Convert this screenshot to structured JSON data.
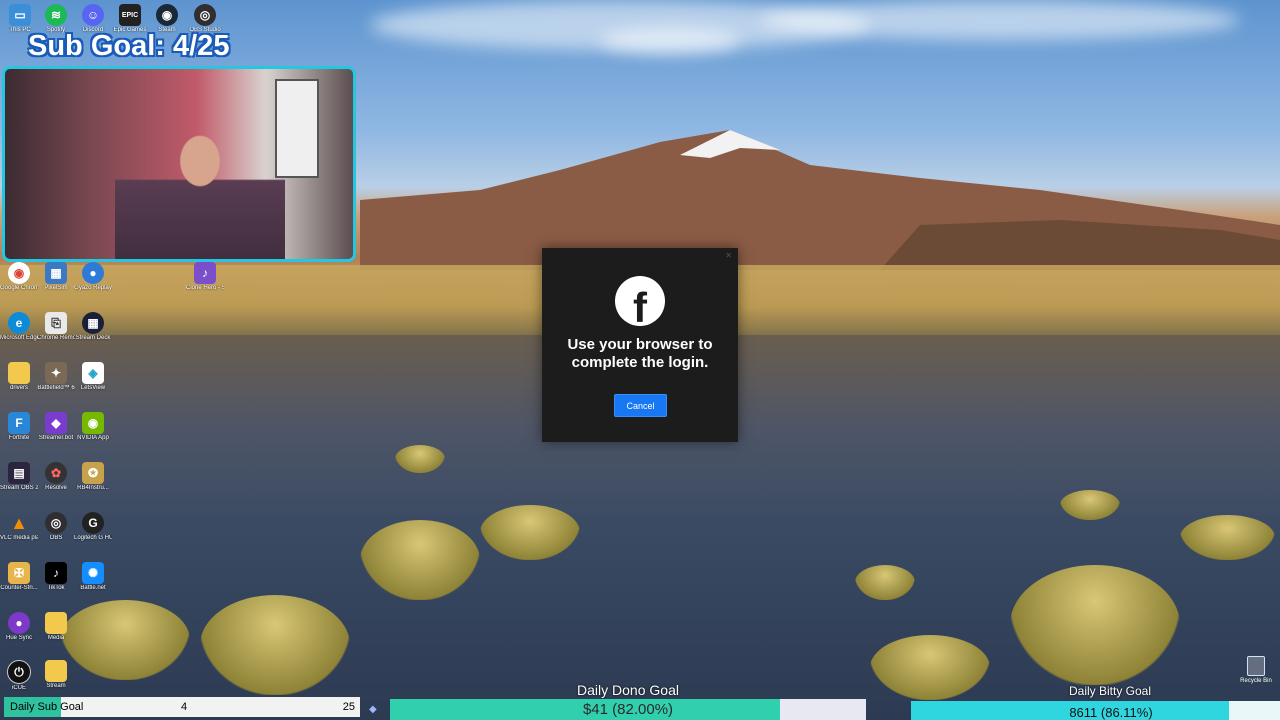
{
  "sub_goal_overlay": "Sub Goal: 4/25",
  "dialog": {
    "message_line1": "Use your browser to",
    "message_line2": "complete the login.",
    "cancel_label": "Cancel",
    "close_label": "✕"
  },
  "sub_goal_bar": {
    "label": "Daily Sub Goal",
    "current": "4",
    "max": "25",
    "progress": 0.16
  },
  "dono_goal": {
    "title": "Daily Dono Goal",
    "value": "$41 (82.00%)",
    "progress": 0.82
  },
  "bitty_goal": {
    "title": "Daily Bitty Goal",
    "value": "8611 (86.11%)",
    "progress": 0.8611
  },
  "desktop_icons": {
    "this_pc": "This PC",
    "spotify": "Spotify",
    "discord": "Discord",
    "epic": "Epic Games",
    "steam": "Steam",
    "obs": "OBS Studio",
    "chrome": "Google Chrome",
    "pixelsim": "PixelSim",
    "gyazo": "Gyazo Replay",
    "clone_hero": "Clone Hero - Shortcut",
    "edge": "Microsoft Edge",
    "chrome_remote": "Chrome Remo...",
    "stream_deck": "Stream Deck",
    "drivers": "drivers",
    "battlefield": "Battlefield™ 6",
    "letsview": "LetsView",
    "fortnite": "Fortnite",
    "streamer_bot": "Streamer.bot",
    "nvidia": "NVIDIA App",
    "stream_obs": "Stream OBS 2020",
    "resolve": "Resolve",
    "rb4": "RB4Instru...",
    "vlc": "VLC media player",
    "obs2": "OBS",
    "logitech": "Logitech G HUB",
    "counter_strike": "Counter-Stri...",
    "tiktok": "TikTok",
    "battlenet": "Battle.net",
    "hue_sync": "Hue Sync",
    "media": "Media",
    "icue": "iCUE",
    "stream": "Stream",
    "recycle_bin": "Recycle Bin"
  }
}
